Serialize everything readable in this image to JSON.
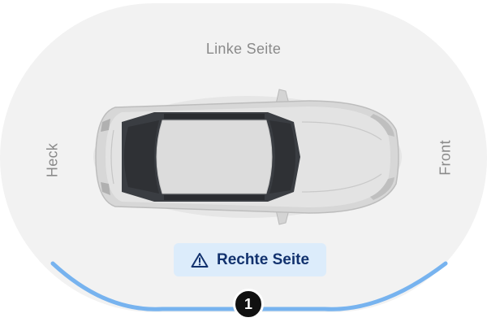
{
  "sides": {
    "left": "Linke Seite",
    "rear": "Heck",
    "front": "Front",
    "right": "Rechte Seite"
  },
  "selected_side": "Rechte Seite",
  "marker": {
    "number": "1"
  },
  "icons": {
    "warning": "warning-triangle-icon",
    "vehicle": "car-top-view"
  },
  "colors": {
    "track_background": "#f2f2f2",
    "highlight_arc": "#77b3ef",
    "chip_background": "#dcecfb",
    "chip_text": "#12326e",
    "label_text": "#8a8a8a"
  }
}
